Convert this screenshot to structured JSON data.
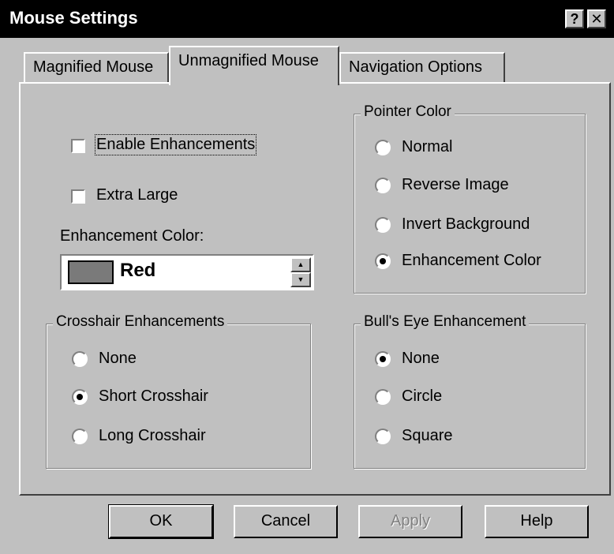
{
  "window": {
    "title": "Mouse Settings",
    "help_label": "?",
    "close_label": "✕"
  },
  "tabs": [
    {
      "label": "Magnified Mouse"
    },
    {
      "label": "Unmagnified Mouse"
    },
    {
      "label": "Navigation Options"
    }
  ],
  "options": {
    "enable_enhancements": {
      "label": "Enable Enhancements",
      "checked": false
    },
    "extra_large": {
      "label": "Extra Large",
      "checked": false
    }
  },
  "enhancement_color": {
    "label": "Enhancement Color:",
    "value": "Red",
    "swatch_color": "#7a7a7a"
  },
  "crosshair": {
    "title": "Crosshair Enhancements",
    "items": [
      {
        "label": "None",
        "selected": false
      },
      {
        "label": "Short Crosshair",
        "selected": true
      },
      {
        "label": "Long Crosshair",
        "selected": false
      }
    ]
  },
  "pointer_color": {
    "title": "Pointer Color",
    "items": [
      {
        "label": "Normal",
        "selected": false
      },
      {
        "label": "Reverse Image",
        "selected": false
      },
      {
        "label": "Invert Background",
        "selected": false
      },
      {
        "label": "Enhancement Color",
        "selected": true
      }
    ]
  },
  "bulls_eye": {
    "title": "Bull's Eye Enhancement",
    "items": [
      {
        "label": "None",
        "selected": true
      },
      {
        "label": "Circle",
        "selected": false
      },
      {
        "label": "Square",
        "selected": false
      }
    ]
  },
  "buttons": {
    "ok": "OK",
    "cancel": "Cancel",
    "apply": "Apply",
    "help": "Help"
  },
  "icons": {
    "help": "question-mark-icon",
    "close": "close-icon",
    "spin_up": "up-arrow-icon",
    "spin_down": "down-arrow-icon"
  }
}
